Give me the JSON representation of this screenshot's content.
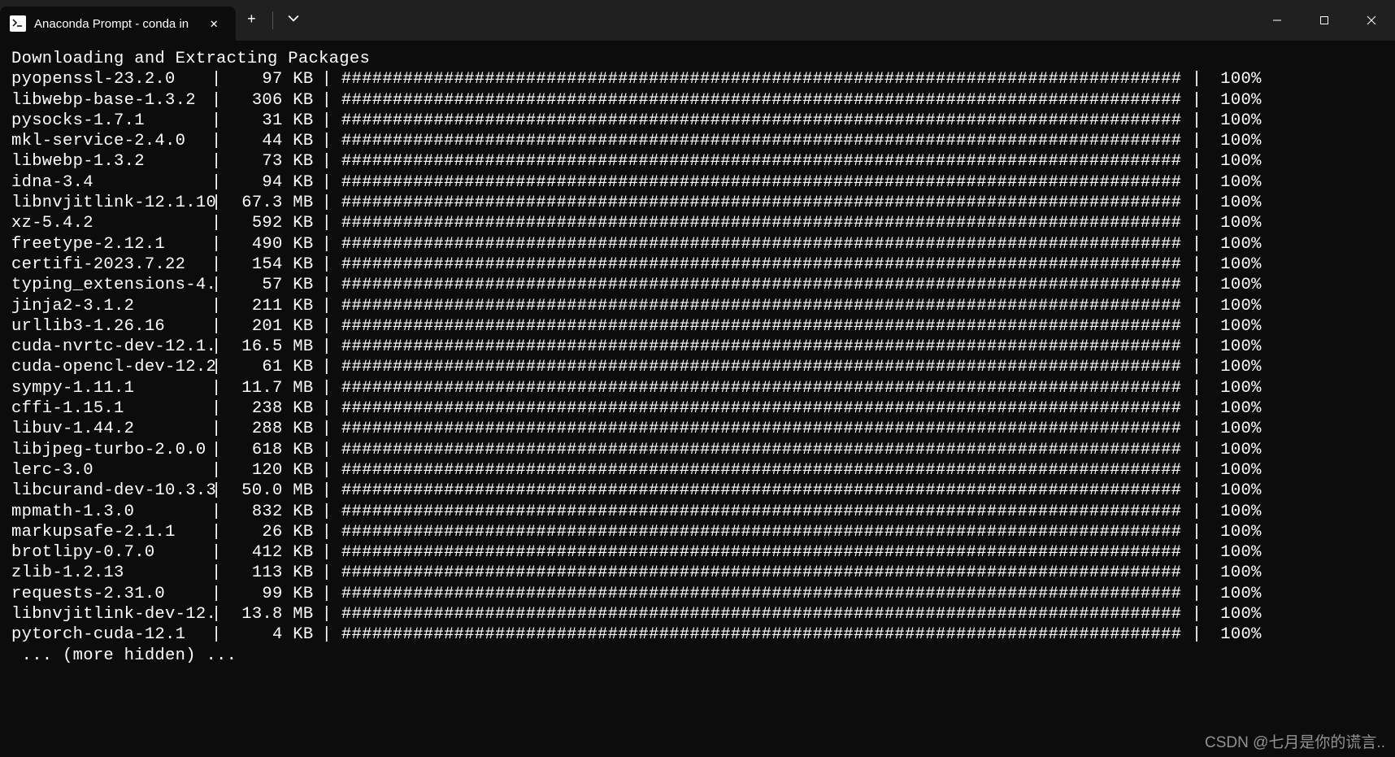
{
  "window": {
    "tab_title": "Anaconda Prompt - conda  in",
    "tab_close": "✕",
    "new_tab": "+",
    "dropdown": "⌄"
  },
  "terminal": {
    "heading": "Downloading and Extracting Packages",
    "bar_full": "##################################################################################",
    "more_hidden": " ... (more hidden) ...",
    "packages": [
      {
        "name": "pyopenssl-23.2.0",
        "size": "97 KB",
        "pct": "100%"
      },
      {
        "name": "libwebp-base-1.3.2",
        "size": "306 KB",
        "pct": "100%"
      },
      {
        "name": "pysocks-1.7.1",
        "size": "31 KB",
        "pct": "100%"
      },
      {
        "name": "mkl-service-2.4.0",
        "size": "44 KB",
        "pct": "100%"
      },
      {
        "name": "libwebp-1.3.2",
        "size": "73 KB",
        "pct": "100%"
      },
      {
        "name": "idna-3.4",
        "size": "94 KB",
        "pct": "100%"
      },
      {
        "name": "libnvjitlink-12.1.10",
        "size": "67.3 MB",
        "pct": "100%"
      },
      {
        "name": "xz-5.4.2",
        "size": "592 KB",
        "pct": "100%"
      },
      {
        "name": "freetype-2.12.1",
        "size": "490 KB",
        "pct": "100%"
      },
      {
        "name": "certifi-2023.7.22",
        "size": "154 KB",
        "pct": "100%"
      },
      {
        "name": "typing_extensions-4.",
        "size": "57 KB",
        "pct": "100%"
      },
      {
        "name": "jinja2-3.1.2",
        "size": "211 KB",
        "pct": "100%"
      },
      {
        "name": "urllib3-1.26.16",
        "size": "201 KB",
        "pct": "100%"
      },
      {
        "name": "cuda-nvrtc-dev-12.1.",
        "size": "16.5 MB",
        "pct": "100%"
      },
      {
        "name": "cuda-opencl-dev-12.2",
        "size": "61 KB",
        "pct": "100%"
      },
      {
        "name": "sympy-1.11.1",
        "size": "11.7 MB",
        "pct": "100%"
      },
      {
        "name": "cffi-1.15.1",
        "size": "238 KB",
        "pct": "100%"
      },
      {
        "name": "libuv-1.44.2",
        "size": "288 KB",
        "pct": "100%"
      },
      {
        "name": "libjpeg-turbo-2.0.0",
        "size": "618 KB",
        "pct": "100%"
      },
      {
        "name": "lerc-3.0",
        "size": "120 KB",
        "pct": "100%"
      },
      {
        "name": "libcurand-dev-10.3.3",
        "size": "50.0 MB",
        "pct": "100%"
      },
      {
        "name": "mpmath-1.3.0",
        "size": "832 KB",
        "pct": "100%"
      },
      {
        "name": "markupsafe-2.1.1",
        "size": "26 KB",
        "pct": "100%"
      },
      {
        "name": "brotlipy-0.7.0",
        "size": "412 KB",
        "pct": "100%"
      },
      {
        "name": "zlib-1.2.13",
        "size": "113 KB",
        "pct": "100%"
      },
      {
        "name": "requests-2.31.0",
        "size": "99 KB",
        "pct": "100%"
      },
      {
        "name": "libnvjitlink-dev-12.",
        "size": "13.8 MB",
        "pct": "100%"
      },
      {
        "name": "pytorch-cuda-12.1",
        "size": "4 KB",
        "pct": "100%"
      }
    ]
  },
  "watermark": "CSDN @七月是你的谎言.."
}
